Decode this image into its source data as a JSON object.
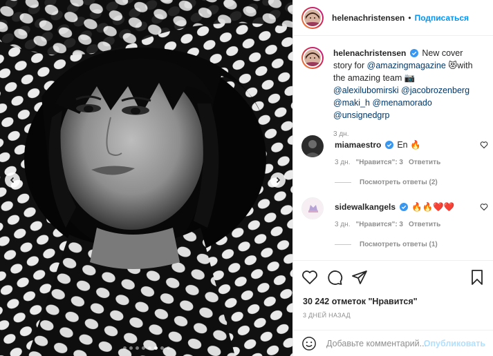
{
  "post": {
    "author": "helenachristensen",
    "follow_label": "Подписаться",
    "separator": "•",
    "carousel": {
      "total_slides": 8,
      "active_index": 5
    }
  },
  "caption": {
    "username": "helenachristensen",
    "text_1": "New cover story for",
    "mention_1": "@amazingmagazine",
    "emoji_1": "😻",
    "text_2": "with the amazing team",
    "emoji_2": "📷",
    "mention_2": "@alexilubomirski",
    "mention_3": "@jacobrozenberg",
    "mention_4": "@maki_h",
    "mention_5": "@menamorado",
    "mention_6": "@unsignedgrp",
    "time": "3 дн."
  },
  "comments": [
    {
      "username": "miamaestro",
      "text": "En 🔥",
      "time": "3 дн.",
      "likes_label": "\"Нравится\": 3",
      "reply_label": "Ответить",
      "view_replies": "Посмотреть ответы (2)"
    },
    {
      "username": "sidewalkangels",
      "text": "🔥🔥❤️❤️",
      "time": "3 дн.",
      "likes_label": "\"Нравится\": 3",
      "reply_label": "Ответить",
      "view_replies": "Посмотреть ответы (1)"
    }
  ],
  "engagement": {
    "likes_text": "30 242 отметок \"Нравится\"",
    "date_text": "3 ДНЕЙ НАЗАД"
  },
  "add_comment": {
    "placeholder": "Добавьте комментарий...",
    "publish_label": "Опубликовать"
  },
  "colors": {
    "accent": "#0095f6",
    "publish_disabled": "#b2dffc",
    "verified": "#3897f0",
    "muted": "#8e8e8e"
  }
}
